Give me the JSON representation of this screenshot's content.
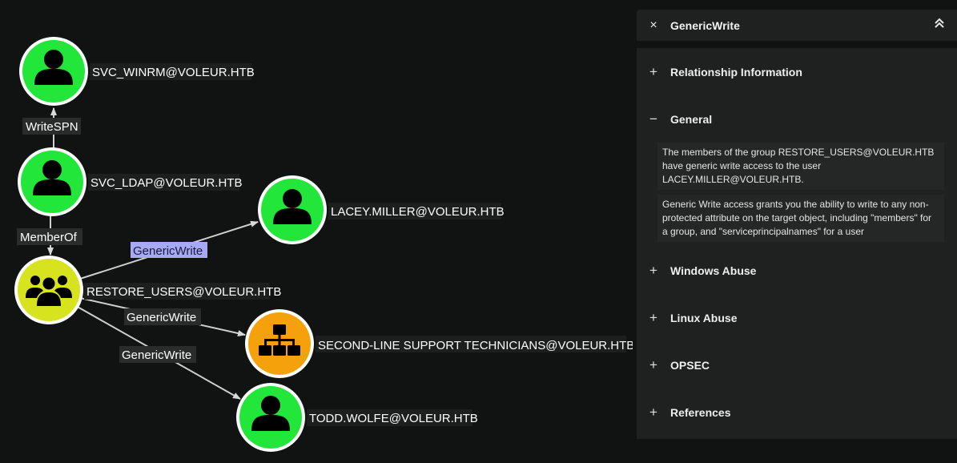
{
  "graph": {
    "nodes": {
      "svc_winrm": "SVC_WINRM@VOLEUR.HTB",
      "svc_ldap": "SVC_LDAP@VOLEUR.HTB",
      "lacey": "LACEY.MILLER@VOLEUR.HTB",
      "restore_users": "RESTORE_USERS@VOLEUR.HTB",
      "second_line": "SECOND-LINE SUPPORT TECHNICIANS@VOLEUR.HTB",
      "todd": "TODD.WOLFE@VOLEUR.HTB"
    },
    "edges": {
      "writespn": "WriteSPN",
      "memberof": "MemberOf",
      "gw_lacey": "GenericWrite",
      "gw_second": "GenericWrite",
      "gw_todd": "GenericWrite"
    },
    "colors": {
      "user": "#22e639",
      "group": "#d8e31f",
      "ou": "#f5a10b",
      "selected_edge": "#a6aaf5"
    }
  },
  "panel": {
    "close_icon": "×",
    "title": "GenericWrite",
    "sections": [
      {
        "sign": "+",
        "title": "Relationship Information"
      },
      {
        "sign": "−",
        "title": "General"
      },
      {
        "sign": "+",
        "title": "Windows Abuse"
      },
      {
        "sign": "+",
        "title": "Linux Abuse"
      },
      {
        "sign": "+",
        "title": "OPSEC"
      },
      {
        "sign": "+",
        "title": "References"
      }
    ],
    "general_paragraphs": [
      "The members of the group RESTORE_USERS@VOLEUR.HTB have generic write access to the user LACEY.MILLER@VOLEUR.HTB.",
      "Generic Write access grants you the ability to write to any non-protected attribute on the target object, including \"members\" for a group, and \"serviceprincipalnames\" for a user"
    ]
  }
}
